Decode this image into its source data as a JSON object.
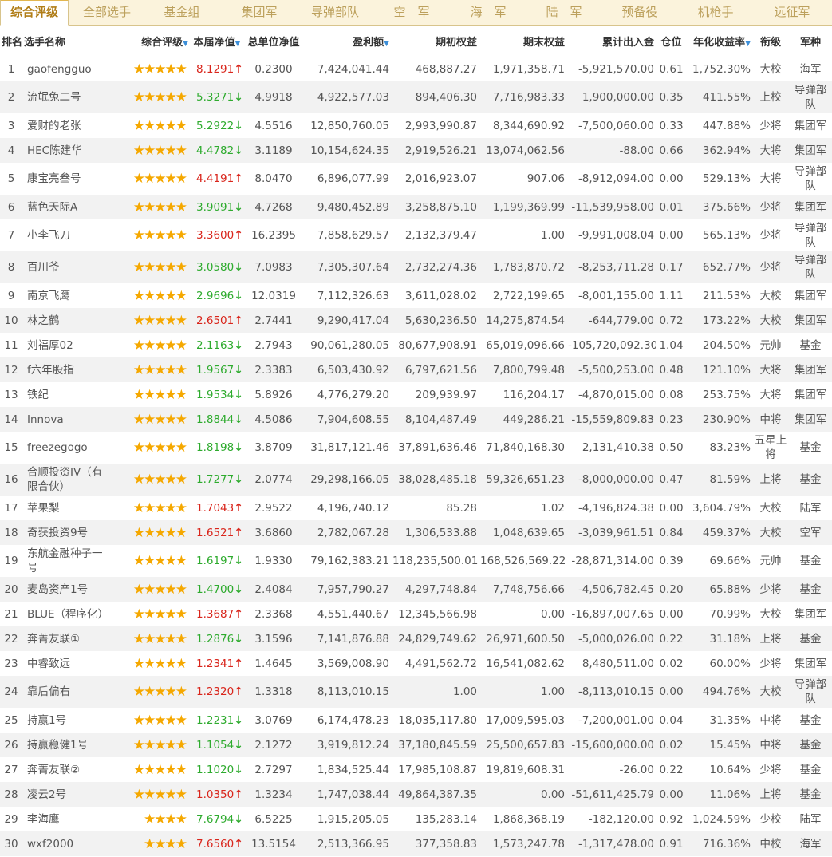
{
  "tabs": [
    "综合评级",
    "全部选手",
    "基金组",
    "集团军",
    "导弹部队",
    "空　军",
    "海　军",
    "陆　军",
    "预备役",
    "机枪手",
    "远征军"
  ],
  "active_tab": 0,
  "columns": [
    "排名",
    "选手名称",
    "综合评级",
    "本届净值",
    "总单位净值",
    "盈利额",
    "期初权益",
    "期末权益",
    "累计出入金",
    "仓位",
    "年化收益率",
    "衔级",
    "军种"
  ],
  "colors": {
    "up": "#d9261c",
    "down": "#2eab2e",
    "star": "#f5a800",
    "tab_accent": "#b07d17",
    "sort": "#3d8fd8"
  },
  "rows": [
    {
      "rank": "1",
      "name": "gaofengguo",
      "stars": 5,
      "nav": "8.1291",
      "dir": "up",
      "unit": "0.2300",
      "profit": "7,424,041.44",
      "begin": "468,887.27",
      "end": "1,971,358.71",
      "flow": "-5,921,570.00",
      "pos": "0.61",
      "annual": "1,752.30%",
      "rankname": "大校",
      "branch": "海军"
    },
    {
      "rank": "2",
      "name": "流氓兔二号",
      "stars": 5,
      "nav": "5.3271",
      "dir": "down",
      "unit": "4.9918",
      "profit": "4,922,577.03",
      "begin": "894,406.30",
      "end": "7,716,983.33",
      "flow": "1,900,000.00",
      "pos": "0.35",
      "annual": "411.55%",
      "rankname": "上校",
      "branch": "导弹部队"
    },
    {
      "rank": "3",
      "name": "爱财的老张",
      "stars": 5,
      "nav": "5.2922",
      "dir": "down",
      "unit": "4.5516",
      "profit": "12,850,760.05",
      "begin": "2,993,990.87",
      "end": "8,344,690.92",
      "flow": "-7,500,060.00",
      "pos": "0.33",
      "annual": "447.88%",
      "rankname": "少将",
      "branch": "集团军"
    },
    {
      "rank": "4",
      "name": "HEC陈建华",
      "stars": 5,
      "nav": "4.4782",
      "dir": "down",
      "unit": "3.1189",
      "profit": "10,154,624.35",
      "begin": "2,919,526.21",
      "end": "13,074,062.56",
      "flow": "-88.00",
      "pos": "0.66",
      "annual": "362.94%",
      "rankname": "大将",
      "branch": "集团军"
    },
    {
      "rank": "5",
      "name": "康宝亮叁号",
      "stars": 5,
      "nav": "4.4191",
      "dir": "up",
      "unit": "8.0470",
      "profit": "6,896,077.99",
      "begin": "2,016,923.07",
      "end": "907.06",
      "flow": "-8,912,094.00",
      "pos": "0.00",
      "annual": "529.13%",
      "rankname": "大将",
      "branch": "导弹部队"
    },
    {
      "rank": "6",
      "name": "蓝色天际A",
      "stars": 5,
      "nav": "3.9091",
      "dir": "down",
      "unit": "4.7268",
      "profit": "9,480,452.89",
      "begin": "3,258,875.10",
      "end": "1,199,369.99",
      "flow": "-11,539,958.00",
      "pos": "0.01",
      "annual": "375.66%",
      "rankname": "少将",
      "branch": "集团军"
    },
    {
      "rank": "7",
      "name": "小李飞刀",
      "stars": 5,
      "nav": "3.3600",
      "dir": "up",
      "unit": "16.2395",
      "profit": "7,858,629.57",
      "begin": "2,132,379.47",
      "end": "1.00",
      "flow": "-9,991,008.04",
      "pos": "0.00",
      "annual": "565.13%",
      "rankname": "少将",
      "branch": "导弹部队"
    },
    {
      "rank": "8",
      "name": "百川爷",
      "stars": 5,
      "nav": "3.0580",
      "dir": "down",
      "unit": "7.0983",
      "profit": "7,305,307.64",
      "begin": "2,732,274.36",
      "end": "1,783,870.72",
      "flow": "-8,253,711.28",
      "pos": "0.17",
      "annual": "652.77%",
      "rankname": "少将",
      "branch": "导弹部队"
    },
    {
      "rank": "9",
      "name": "南京飞鹰",
      "stars": 5,
      "nav": "2.9696",
      "dir": "down",
      "unit": "12.0319",
      "profit": "7,112,326.63",
      "begin": "3,611,028.02",
      "end": "2,722,199.65",
      "flow": "-8,001,155.00",
      "pos": "1.11",
      "annual": "211.53%",
      "rankname": "大校",
      "branch": "集团军"
    },
    {
      "rank": "10",
      "name": "林之鹤",
      "stars": 5,
      "nav": "2.6501",
      "dir": "up",
      "unit": "2.7441",
      "profit": "9,290,417.04",
      "begin": "5,630,236.50",
      "end": "14,275,874.54",
      "flow": "-644,779.00",
      "pos": "0.72",
      "annual": "173.22%",
      "rankname": "大校",
      "branch": "集团军"
    },
    {
      "rank": "11",
      "name": "刘福厚02",
      "stars": 5,
      "nav": "2.1163",
      "dir": "down",
      "unit": "2.7943",
      "profit": "90,061,280.05",
      "begin": "80,677,908.91",
      "end": "65,019,096.66",
      "flow": "-105,720,092.30",
      "pos": "1.04",
      "annual": "204.50%",
      "rankname": "元帅",
      "branch": "基金"
    },
    {
      "rank": "12",
      "name": "f六年股指",
      "stars": 5,
      "nav": "1.9567",
      "dir": "down",
      "unit": "2.3383",
      "profit": "6,503,430.92",
      "begin": "6,797,621.56",
      "end": "7,800,799.48",
      "flow": "-5,500,253.00",
      "pos": "0.48",
      "annual": "121.10%",
      "rankname": "大将",
      "branch": "集团军"
    },
    {
      "rank": "13",
      "name": "铁纪",
      "stars": 5,
      "nav": "1.9534",
      "dir": "down",
      "unit": "5.8926",
      "profit": "4,776,279.20",
      "begin": "209,939.97",
      "end": "116,204.17",
      "flow": "-4,870,015.00",
      "pos": "0.08",
      "annual": "253.75%",
      "rankname": "大将",
      "branch": "集团军"
    },
    {
      "rank": "14",
      "name": "Innova",
      "stars": 5,
      "nav": "1.8844",
      "dir": "down",
      "unit": "4.5086",
      "profit": "7,904,608.55",
      "begin": "8,104,487.49",
      "end": "449,286.21",
      "flow": "-15,559,809.83",
      "pos": "0.23",
      "annual": "230.90%",
      "rankname": "中将",
      "branch": "集团军"
    },
    {
      "rank": "15",
      "name": "freezegogo",
      "stars": 5,
      "nav": "1.8198",
      "dir": "down",
      "unit": "3.8709",
      "profit": "31,817,121.46",
      "begin": "37,891,636.46",
      "end": "71,840,168.30",
      "flow": "2,131,410.38",
      "pos": "0.50",
      "annual": "83.23%",
      "rankname": "五星上将",
      "branch": "基金"
    },
    {
      "rank": "16",
      "name": "合顺投资IV（有限合伙）",
      "stars": 5,
      "nav": "1.7277",
      "dir": "down",
      "unit": "2.0774",
      "profit": "29,298,166.05",
      "begin": "38,028,485.18",
      "end": "59,326,651.23",
      "flow": "-8,000,000.00",
      "pos": "0.47",
      "annual": "81.59%",
      "rankname": "上将",
      "branch": "基金"
    },
    {
      "rank": "17",
      "name": "苹果梨",
      "stars": 5,
      "nav": "1.7043",
      "dir": "up",
      "unit": "2.9522",
      "profit": "4,196,740.12",
      "begin": "85.28",
      "end": "1.02",
      "flow": "-4,196,824.38",
      "pos": "0.00",
      "annual": "3,604.79%",
      "rankname": "大校",
      "branch": "陆军"
    },
    {
      "rank": "18",
      "name": "奇获投资9号",
      "stars": 5,
      "nav": "1.6521",
      "dir": "up",
      "unit": "3.6860",
      "profit": "2,782,067.28",
      "begin": "1,306,533.88",
      "end": "1,048,639.65",
      "flow": "-3,039,961.51",
      "pos": "0.84",
      "annual": "459.37%",
      "rankname": "大校",
      "branch": "空军"
    },
    {
      "rank": "19",
      "name": "东航金融种子一号",
      "stars": 5,
      "nav": "1.6197",
      "dir": "down",
      "unit": "1.9330",
      "profit": "79,162,383.21",
      "begin": "118,235,500.01",
      "end": "168,526,569.22",
      "flow": "-28,871,314.00",
      "pos": "0.39",
      "annual": "69.66%",
      "rankname": "元帅",
      "branch": "基金"
    },
    {
      "rank": "20",
      "name": "麦岛资产1号",
      "stars": 5,
      "nav": "1.4700",
      "dir": "down",
      "unit": "2.4084",
      "profit": "7,957,790.27",
      "begin": "4,297,748.84",
      "end": "7,748,756.66",
      "flow": "-4,506,782.45",
      "pos": "0.20",
      "annual": "65.88%",
      "rankname": "少将",
      "branch": "基金"
    },
    {
      "rank": "21",
      "name": "BLUE（程序化）",
      "stars": 5,
      "nav": "1.3687",
      "dir": "up",
      "unit": "2.3368",
      "profit": "4,551,440.67",
      "begin": "12,345,566.98",
      "end": "0.00",
      "flow": "-16,897,007.65",
      "pos": "0.00",
      "annual": "70.99%",
      "rankname": "大校",
      "branch": "集团军"
    },
    {
      "rank": "22",
      "name": "奔菁友联①",
      "stars": 5,
      "nav": "1.2876",
      "dir": "down",
      "unit": "3.1596",
      "profit": "7,141,876.88",
      "begin": "24,829,749.62",
      "end": "26,971,600.50",
      "flow": "-5,000,026.00",
      "pos": "0.22",
      "annual": "31.18%",
      "rankname": "上将",
      "branch": "基金"
    },
    {
      "rank": "23",
      "name": "中睿致远",
      "stars": 5,
      "nav": "1.2341",
      "dir": "up",
      "unit": "1.4645",
      "profit": "3,569,008.90",
      "begin": "4,491,562.72",
      "end": "16,541,082.62",
      "flow": "8,480,511.00",
      "pos": "0.02",
      "annual": "60.00%",
      "rankname": "少将",
      "branch": "集团军"
    },
    {
      "rank": "24",
      "name": "靠后偏右",
      "stars": 5,
      "nav": "1.2320",
      "dir": "up",
      "unit": "1.3318",
      "profit": "8,113,010.15",
      "begin": "1.00",
      "end": "1.00",
      "flow": "-8,113,010.15",
      "pos": "0.00",
      "annual": "494.76%",
      "rankname": "大校",
      "branch": "导弹部队"
    },
    {
      "rank": "25",
      "name": "持赢1号",
      "stars": 5,
      "nav": "1.2231",
      "dir": "down",
      "unit": "3.0769",
      "profit": "6,174,478.23",
      "begin": "18,035,117.80",
      "end": "17,009,595.03",
      "flow": "-7,200,001.00",
      "pos": "0.04",
      "annual": "31.35%",
      "rankname": "中将",
      "branch": "基金"
    },
    {
      "rank": "26",
      "name": "持赢稳健1号",
      "stars": 5,
      "nav": "1.1054",
      "dir": "down",
      "unit": "2.1272",
      "profit": "3,919,812.24",
      "begin": "37,180,845.59",
      "end": "25,500,657.83",
      "flow": "-15,600,000.00",
      "pos": "0.02",
      "annual": "15.45%",
      "rankname": "中将",
      "branch": "基金"
    },
    {
      "rank": "27",
      "name": "奔菁友联②",
      "stars": 5,
      "nav": "1.1020",
      "dir": "down",
      "unit": "2.7297",
      "profit": "1,834,525.44",
      "begin": "17,985,108.87",
      "end": "19,819,608.31",
      "flow": "-26.00",
      "pos": "0.22",
      "annual": "10.64%",
      "rankname": "少将",
      "branch": "基金"
    },
    {
      "rank": "28",
      "name": "凌云2号",
      "stars": 5,
      "nav": "1.0350",
      "dir": "up",
      "unit": "1.3234",
      "profit": "1,747,038.44",
      "begin": "49,864,387.35",
      "end": "0.00",
      "flow": "-51,611,425.79",
      "pos": "0.00",
      "annual": "11.06%",
      "rankname": "上将",
      "branch": "基金"
    },
    {
      "rank": "29",
      "name": "李海鹰",
      "stars": 4,
      "nav": "7.6794",
      "dir": "down",
      "unit": "6.5225",
      "profit": "1,915,205.05",
      "begin": "135,283.14",
      "end": "1,868,368.19",
      "flow": "-182,120.00",
      "pos": "0.92",
      "annual": "1,024.59%",
      "rankname": "少校",
      "branch": "陆军"
    },
    {
      "rank": "30",
      "name": "wxf2000",
      "stars": 4,
      "nav": "7.6560",
      "dir": "up",
      "unit": "13.5154",
      "profit": "2,513,366.95",
      "begin": "377,358.83",
      "end": "1,573,247.78",
      "flow": "-1,317,478.00",
      "pos": "0.91",
      "annual": "716.36%",
      "rankname": "中校",
      "branch": "海军"
    }
  ]
}
